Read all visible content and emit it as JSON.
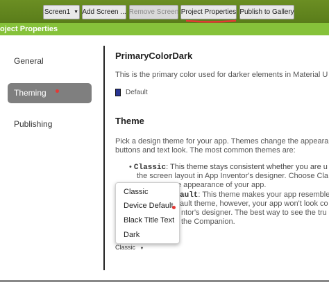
{
  "toolbar": {
    "screen_select": "Screen1",
    "add_screen": "Add Screen ...",
    "remove_screen": "Remove Screen",
    "project_properties": "Project Properties",
    "publish": "Publish to Gallery"
  },
  "dialog": {
    "title": "oject Properties"
  },
  "nav": {
    "items": [
      {
        "label": "General"
      },
      {
        "label": "Theming"
      },
      {
        "label": "Publishing"
      }
    ]
  },
  "primary_dark": {
    "title": "PrimaryColorDark",
    "description": "This is the primary color used for darker elements in Material U",
    "value": "Default",
    "swatch_color": "#283593"
  },
  "theme": {
    "title": "Theme",
    "desc_line1": "Pick a design theme for your app. Themes change the appeara",
    "desc_line2": "buttons and text look. The most common themes are:",
    "classic_code": "Classic",
    "classic_line1": ": This theme stays consistent whether you are u",
    "classic_line2": "the screen layout in App Inventor's designer. Choose Cla",
    "classic_line3": "e appearance of your app.",
    "default_code": "ault",
    "default_line1": ": This theme makes your app resemble",
    "default_line2": "ault theme, however, your app won't look co",
    "default_line3": "ntor's designer. The best way to see the tru",
    "default_line4": "the Companion.",
    "options": [
      "Classic",
      "Device Default",
      "Black Title Text",
      "Dark"
    ],
    "selected": "Classic"
  },
  "colors": {
    "toolbar_bg": "#5a7d1a",
    "title_bg": "#86c23a",
    "active_nav": "#7f7f7f",
    "annotation_red": "#e53935"
  }
}
